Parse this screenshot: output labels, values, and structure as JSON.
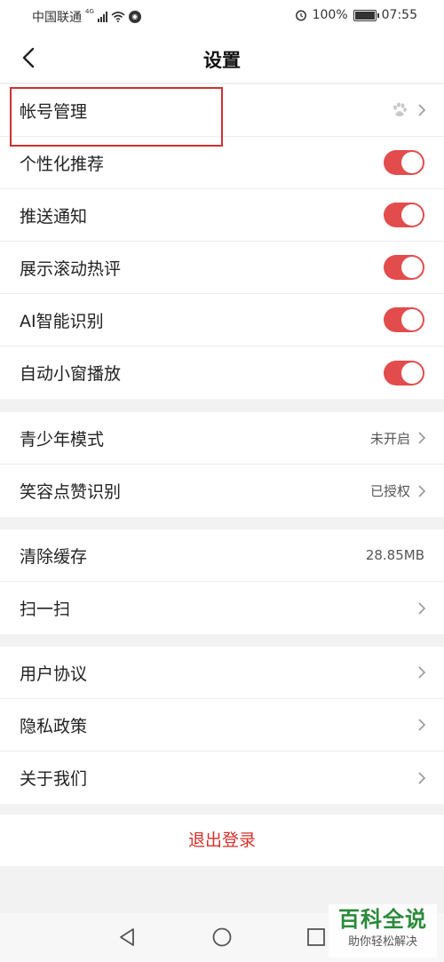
{
  "status_bar": {
    "carrier": "中国联通",
    "network": "4G",
    "battery": "100%",
    "time": "07:55"
  },
  "header": {
    "title": "设置"
  },
  "group1": [
    {
      "label": "帐号管理",
      "type": "link",
      "icon": "paw-icon"
    },
    {
      "label": "个性化推荐",
      "type": "toggle",
      "on": true
    },
    {
      "label": "推送通知",
      "type": "toggle",
      "on": true
    },
    {
      "label": "展示滚动热评",
      "type": "toggle",
      "on": true
    },
    {
      "label": "AI智能识别",
      "type": "toggle",
      "on": true
    },
    {
      "label": "自动小窗播放",
      "type": "toggle",
      "on": true
    }
  ],
  "group2": [
    {
      "label": "青少年模式",
      "value": "未开启"
    },
    {
      "label": "笑容点赞识别",
      "value": "已授权"
    }
  ],
  "group3": [
    {
      "label": "清除缓存",
      "value": "28.85MB"
    },
    {
      "label": "扫一扫",
      "value": ""
    }
  ],
  "group4": [
    {
      "label": "用户协议"
    },
    {
      "label": "隐私政策"
    },
    {
      "label": "关于我们"
    }
  ],
  "logout_label": "退出登录",
  "watermark": {
    "main": "百科全说",
    "sub": "助你轻松解决"
  },
  "colors": {
    "accent": "#e24c4c",
    "logout": "#d6302a",
    "highlight": "#d0302f"
  }
}
